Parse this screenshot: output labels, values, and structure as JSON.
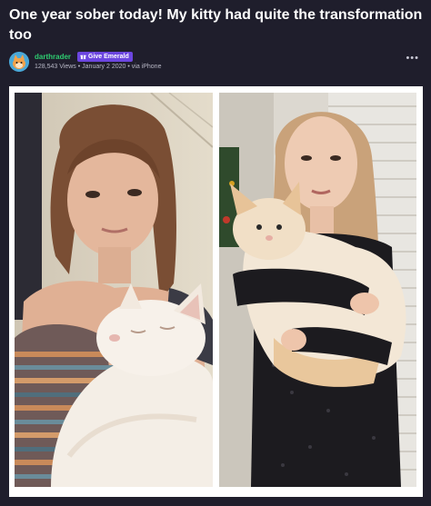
{
  "post": {
    "title": "One year sober today! My kitty had quite the transformation too",
    "author": "darthrader",
    "badge_label": "Give Emerald",
    "views": "128,543 Views",
    "date": "January 2 2020",
    "via": "via iPhone",
    "more_icon": "ellipsis-icon"
  },
  "colors": {
    "background": "#1f1e2c",
    "username": "#2ecc71",
    "badge": "#6c46e0"
  }
}
